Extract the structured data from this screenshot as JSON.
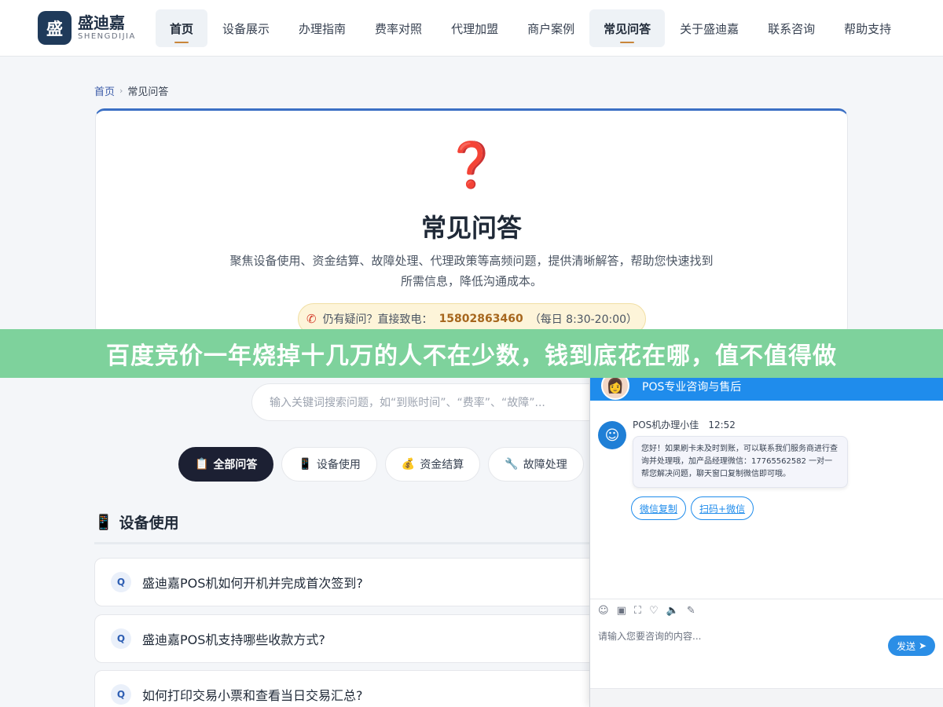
{
  "header": {
    "logo_char": "盛",
    "logo_cn": "盛迪嘉",
    "logo_en": "SHENGDIJIA",
    "nav": [
      {
        "label": "首页",
        "active": true
      },
      {
        "label": "设备展示",
        "active": false
      },
      {
        "label": "办理指南",
        "active": false
      },
      {
        "label": "费率对照",
        "active": false
      },
      {
        "label": "代理加盟",
        "active": false
      },
      {
        "label": "商户案例",
        "active": false
      },
      {
        "label": "常见问答",
        "active": true
      },
      {
        "label": "关于盛迪嘉",
        "active": false
      },
      {
        "label": "联系咨询",
        "active": false
      },
      {
        "label": "帮助支持",
        "active": false
      }
    ]
  },
  "breadcrumb": {
    "home": "首页",
    "sep": "›",
    "current": "常见问答"
  },
  "hero": {
    "icon": "❓",
    "title": "常见问答",
    "desc": "聚焦设备使用、资金结算、故障处理、代理政策等高频问题，提供清晰解答，帮助您快速找到所需信息，降低沟通成本。",
    "hotline_prefix": "仍有疑问？直接致电：",
    "hotline_number": "15802863460",
    "hotline_hours": "（每日 8:30-20:00）"
  },
  "banner": {
    "text": "百度竞价一年烧掉十几万的人不在少数，钱到底花在哪，值不值得做"
  },
  "search": {
    "placeholder": "输入关键词搜索问题，如“到账时间”、“费率”、“故障”..."
  },
  "categories": [
    {
      "icon": "📋",
      "label": "全部问答",
      "active": true
    },
    {
      "icon": "📱",
      "label": "设备使用",
      "active": false
    },
    {
      "icon": "💰",
      "label": "资金结算",
      "active": false
    },
    {
      "icon": "🔧",
      "label": "故障处理",
      "active": false
    }
  ],
  "section": {
    "icon": "📱",
    "title": "设备使用",
    "questions": [
      {
        "badge": "Q",
        "text": "盛迪嘉POS机如何开机并完成首次签到?"
      },
      {
        "badge": "Q",
        "text": "盛迪嘉POS机支持哪些收款方式?"
      },
      {
        "badge": "Q",
        "text": "如何打印交易小票和查看当日交易汇总?"
      }
    ]
  },
  "chat": {
    "title": "POS专业咨询与售后",
    "controls": [
      "—",
      "☐"
    ],
    "agent_name": "POS机办理小佳",
    "time": "12:52",
    "message": "您好！如果刷卡未及时到账，可以联系我们服务商进行查询并处理哦，加产品经理微信：17765562582 一对一帮您解决问题，聊天窗口复制微信即可哦。",
    "quick_buttons": [
      "微信复制",
      "扫码+微信"
    ],
    "toolbar_icons": [
      "☺",
      "▣",
      "⛶",
      "♡",
      "🔈",
      "✎"
    ],
    "input_placeholder": "请输入您要咨询的内容...",
    "send_label": "发送"
  }
}
